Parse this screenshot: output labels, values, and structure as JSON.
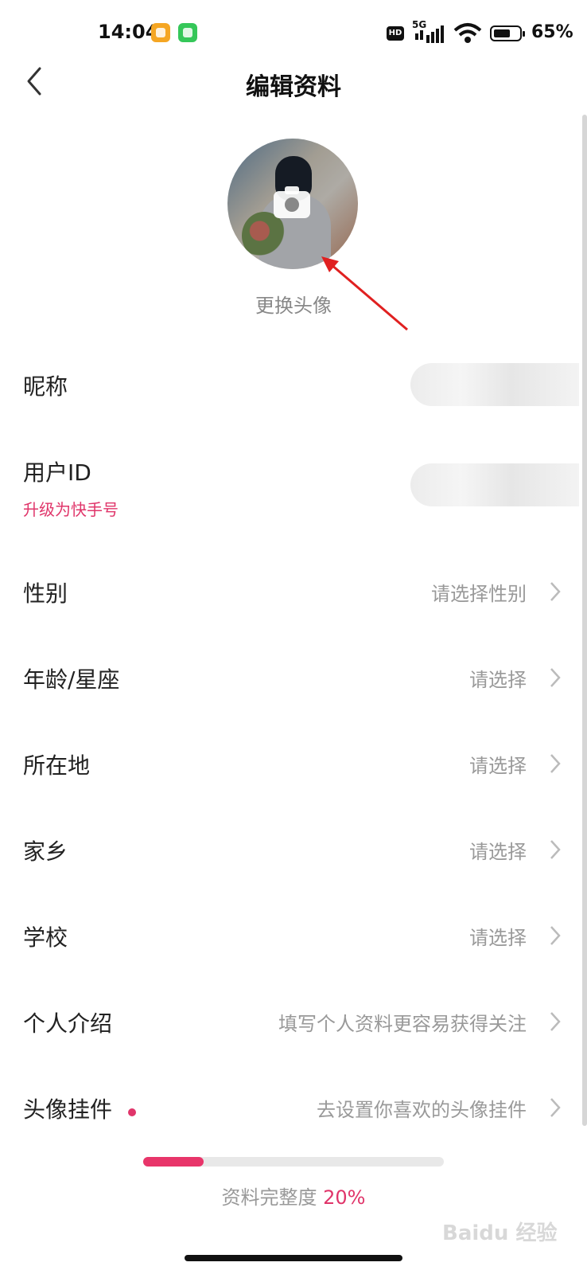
{
  "status_bar": {
    "time": "14:04",
    "hd_badge": "HD",
    "network": "5G",
    "battery_level": 0.65,
    "battery_text": "65%"
  },
  "header": {
    "title": "编辑资料",
    "back_icon": "chevron-left-icon"
  },
  "avatar": {
    "camera_icon": "camera-icon",
    "change_label": "更换头像"
  },
  "rows": [
    {
      "label": "昵称",
      "value": ""
    },
    {
      "label": "用户ID",
      "value": "",
      "sublink": "升级为快手号"
    },
    {
      "label": "性别",
      "value": "请选择性别"
    },
    {
      "label": "年龄/星座",
      "value": "请选择"
    },
    {
      "label": "所在地",
      "value": "请选择"
    },
    {
      "label": "家乡",
      "value": "请选择"
    },
    {
      "label": "学校",
      "value": "请选择"
    },
    {
      "label": "个人介绍",
      "value": "填写个人资料更容易获得关注"
    },
    {
      "label": "头像挂件",
      "value": "去设置你喜欢的头像挂件"
    }
  ],
  "completeness": {
    "label": "资料完整度",
    "percent_text": "20%",
    "fraction": 0.2
  },
  "colors": {
    "accent": "#e0356a"
  },
  "watermark": "Baidu 经验"
}
